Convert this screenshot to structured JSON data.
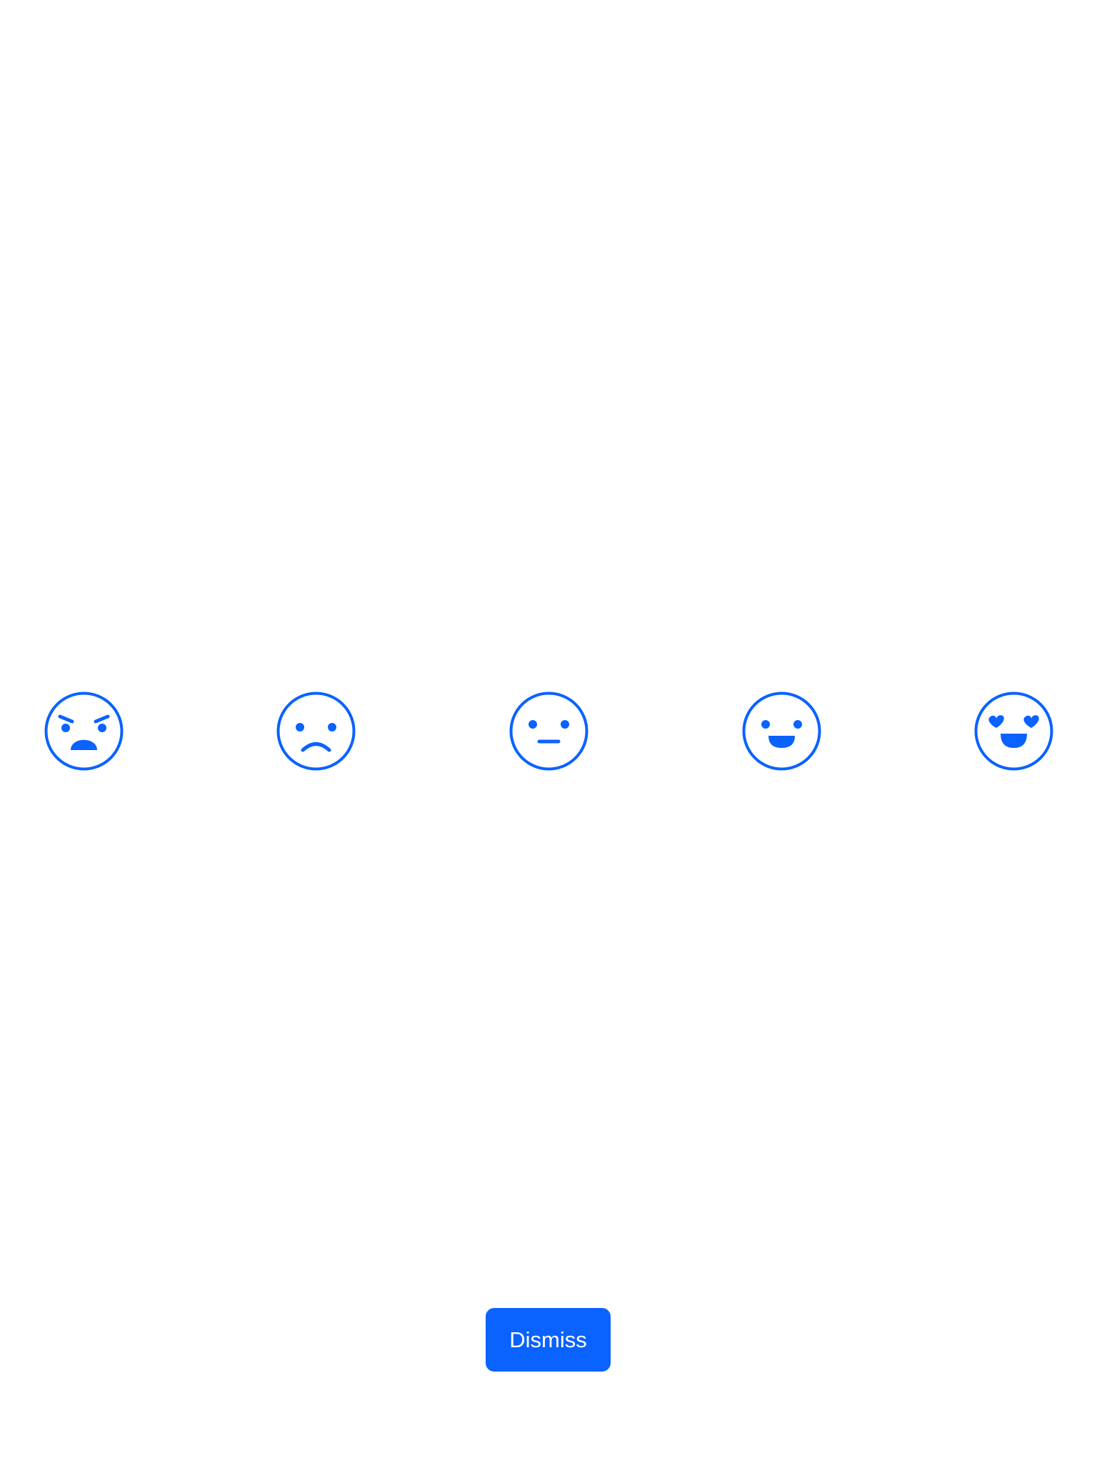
{
  "colors": {
    "accent": "#0a62ff",
    "background": "#ffffff",
    "button_text": "#ffffff"
  },
  "rating": {
    "faces": [
      {
        "icon": "angry-face-icon"
      },
      {
        "icon": "sad-face-icon"
      },
      {
        "icon": "neutral-face-icon"
      },
      {
        "icon": "happy-face-icon"
      },
      {
        "icon": "heart-eyes-face-icon"
      }
    ]
  },
  "dismiss": {
    "label": "Dismiss"
  }
}
